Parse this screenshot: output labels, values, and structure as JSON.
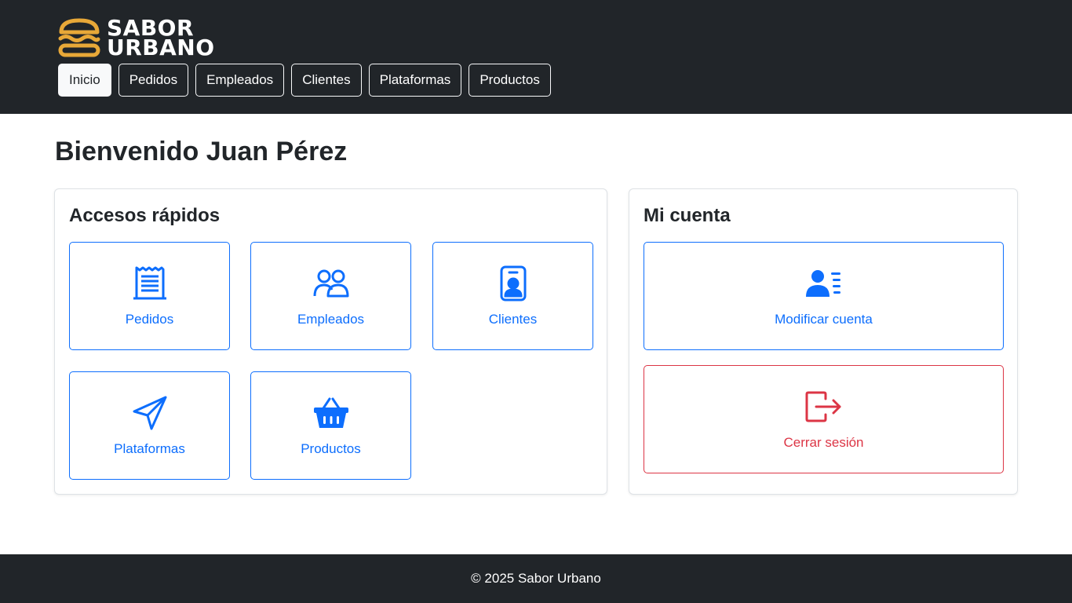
{
  "brand": {
    "line1": "SABOR",
    "line2": "URBANO",
    "logo_icon": "burger-icon",
    "logo_color": "#e8a838"
  },
  "nav": {
    "items": [
      {
        "label": "Inicio",
        "active": true
      },
      {
        "label": "Pedidos"
      },
      {
        "label": "Empleados"
      },
      {
        "label": "Clientes"
      },
      {
        "label": "Plataformas"
      },
      {
        "label": "Productos"
      }
    ]
  },
  "welcome": "Bienvenido Juan Pérez",
  "quick_access": {
    "title": "Accesos rápidos",
    "tiles": [
      {
        "label": "Pedidos",
        "icon": "receipt-icon"
      },
      {
        "label": "Empleados",
        "icon": "people-icon"
      },
      {
        "label": "Clientes",
        "icon": "person-badge-icon"
      },
      {
        "label": "Plataformas",
        "icon": "send-icon"
      },
      {
        "label": "Productos",
        "icon": "basket-icon"
      }
    ]
  },
  "account": {
    "title": "Mi cuenta",
    "modify_label": "Modificar cuenta",
    "modify_icon": "person-lines-icon",
    "logout_label": "Cerrar sesión",
    "logout_icon": "box-arrow-right-icon"
  },
  "footer": {
    "text": "© 2025 Sabor Urbano"
  },
  "colors": {
    "primary": "#0d6efd",
    "danger": "#dc3545",
    "dark": "#212529"
  }
}
